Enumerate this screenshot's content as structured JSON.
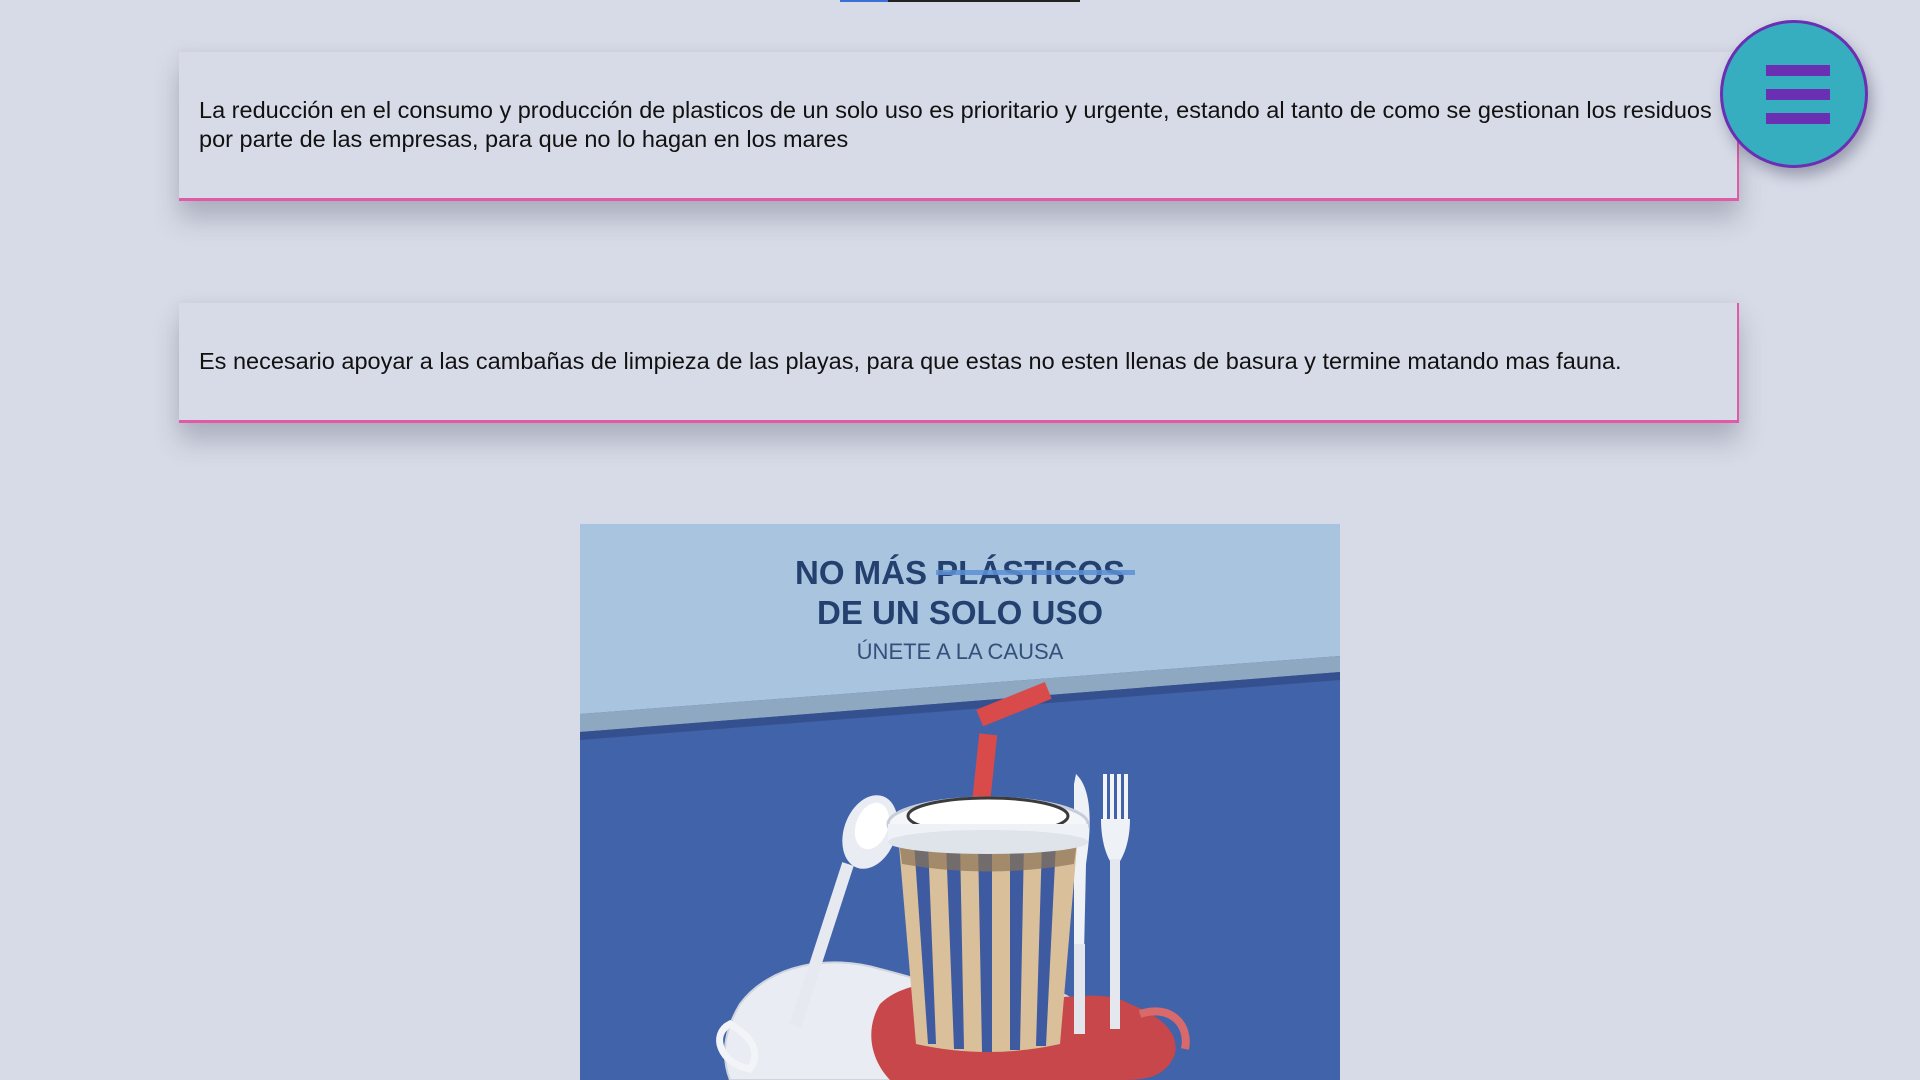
{
  "cards": [
    {
      "text": "La reducción en el consumo y producción de plasticos de un solo uso es prioritario y urgente, estando al tanto de como se gestionan los residuos por parte de las empresas, para que no lo hagan en los mares"
    },
    {
      "text": "Es necesario apoyar a las cambañas de limpieza de las playas, para que estas no esten llenas de basura y termine matando mas fauna."
    }
  ],
  "menu": {
    "icon": "hamburger-menu-icon"
  },
  "poster": {
    "title_line1_a": "NO MÁS ",
    "title_line1_b": "PLÁSTICOS",
    "title_line2": "DE UN SOLO USO",
    "subtitle": "ÚNETE A LA CAUSA",
    "colors": {
      "sky": "#a8c4df",
      "band": "#8aa4c0",
      "background": "#4163aa",
      "title": "#24406f",
      "straw": "#d94a4a"
    }
  }
}
